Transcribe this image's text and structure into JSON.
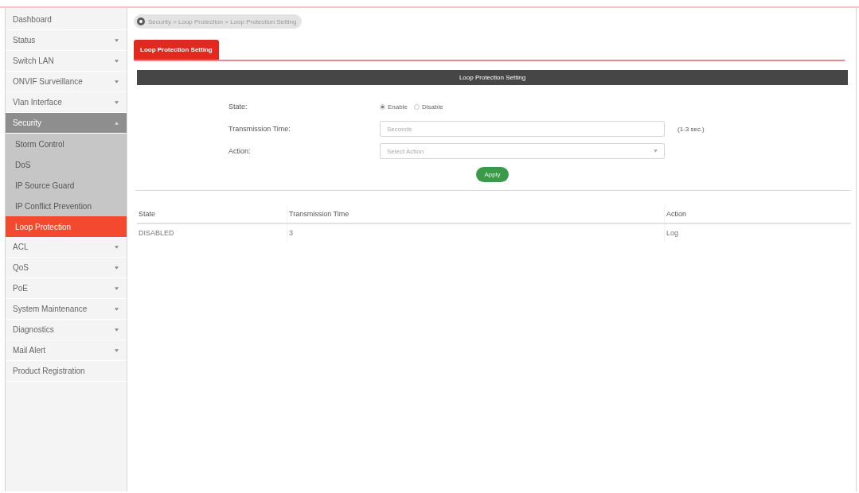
{
  "sidebar": {
    "items": [
      {
        "label": "Dashboard",
        "kind": "link",
        "selected": false
      },
      {
        "label": "Status",
        "kind": "group",
        "expanded": false,
        "selected": false
      },
      {
        "label": "Switch LAN",
        "kind": "group",
        "expanded": false,
        "selected": false
      },
      {
        "label": "ONVIF Surveillance",
        "kind": "group",
        "expanded": false,
        "selected": false
      },
      {
        "label": "Vlan Interface",
        "kind": "group",
        "expanded": false,
        "selected": false
      },
      {
        "label": "Security",
        "kind": "group",
        "expanded": true,
        "selected": false,
        "children": [
          {
            "label": "Storm Control",
            "selected": false
          },
          {
            "label": "DoS",
            "selected": false
          },
          {
            "label": "IP Source Guard",
            "selected": false
          },
          {
            "label": "IP Conflict Prevention",
            "selected": false
          },
          {
            "label": "Loop Protection",
            "selected": true
          }
        ]
      },
      {
        "label": "ACL",
        "kind": "group",
        "expanded": false,
        "selected": false
      },
      {
        "label": "QoS",
        "kind": "group",
        "expanded": false,
        "selected": false
      },
      {
        "label": "PoE",
        "kind": "group",
        "expanded": false,
        "selected": false
      },
      {
        "label": "System Maintenance",
        "kind": "group",
        "expanded": false,
        "selected": false
      },
      {
        "label": "Diagnostics",
        "kind": "group",
        "expanded": false,
        "selected": false
      },
      {
        "label": "Mail Alert",
        "kind": "group",
        "expanded": false,
        "selected": false
      },
      {
        "label": "Product Registration",
        "kind": "link",
        "selected": false
      }
    ]
  },
  "breadcrumb": {
    "text": "Security > Loop Protection > Loop Protection Setting"
  },
  "tabs": [
    {
      "label": "Loop Protection Setting",
      "selected": true
    }
  ],
  "panel": {
    "title": "Loop Protection Setting",
    "form": {
      "state": {
        "label": "State:",
        "options": [
          {
            "label": "Enable",
            "selected": true
          },
          {
            "label": "Disable",
            "selected": false
          }
        ]
      },
      "transmission_time": {
        "label": "Transmission Time:",
        "placeholder": "Seconds",
        "hint": "(1-3 sec.)"
      },
      "action": {
        "label": "Action:",
        "placeholder": "Select Action"
      },
      "apply_button": "Apply"
    }
  },
  "table": {
    "columns": [
      "State",
      "Transmission Time",
      "Action"
    ],
    "rows": [
      [
        "DISABLED",
        "3",
        "Log"
      ]
    ]
  }
}
